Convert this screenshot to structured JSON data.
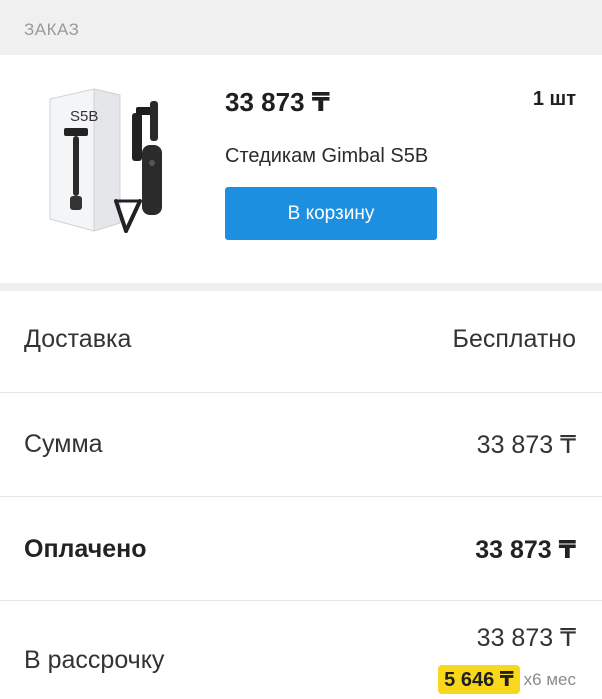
{
  "section": {
    "label": "ЗАКАЗ"
  },
  "product": {
    "price": "33 873 ₸",
    "quantity": "1 шт",
    "title": "Стедикам Gimbal S5B",
    "box_label": "S5B",
    "cart_button": "В корзину"
  },
  "summary": {
    "delivery": {
      "label": "Доставка",
      "value": "Бесплатно"
    },
    "sum": {
      "label": "Сумма",
      "value": "33 873 ₸"
    },
    "paid": {
      "label": "Оплачено",
      "value": "33 873 ₸"
    },
    "installment": {
      "label": "В рассрочку",
      "value": "33 873 ₸",
      "monthly_amount": "5 646 ₸",
      "monthly_term": "x6 мес"
    }
  },
  "colors": {
    "accent_button": "#1c8fe0",
    "installment_highlight": "#f8d81c",
    "section_bg": "#f0f0f0"
  }
}
